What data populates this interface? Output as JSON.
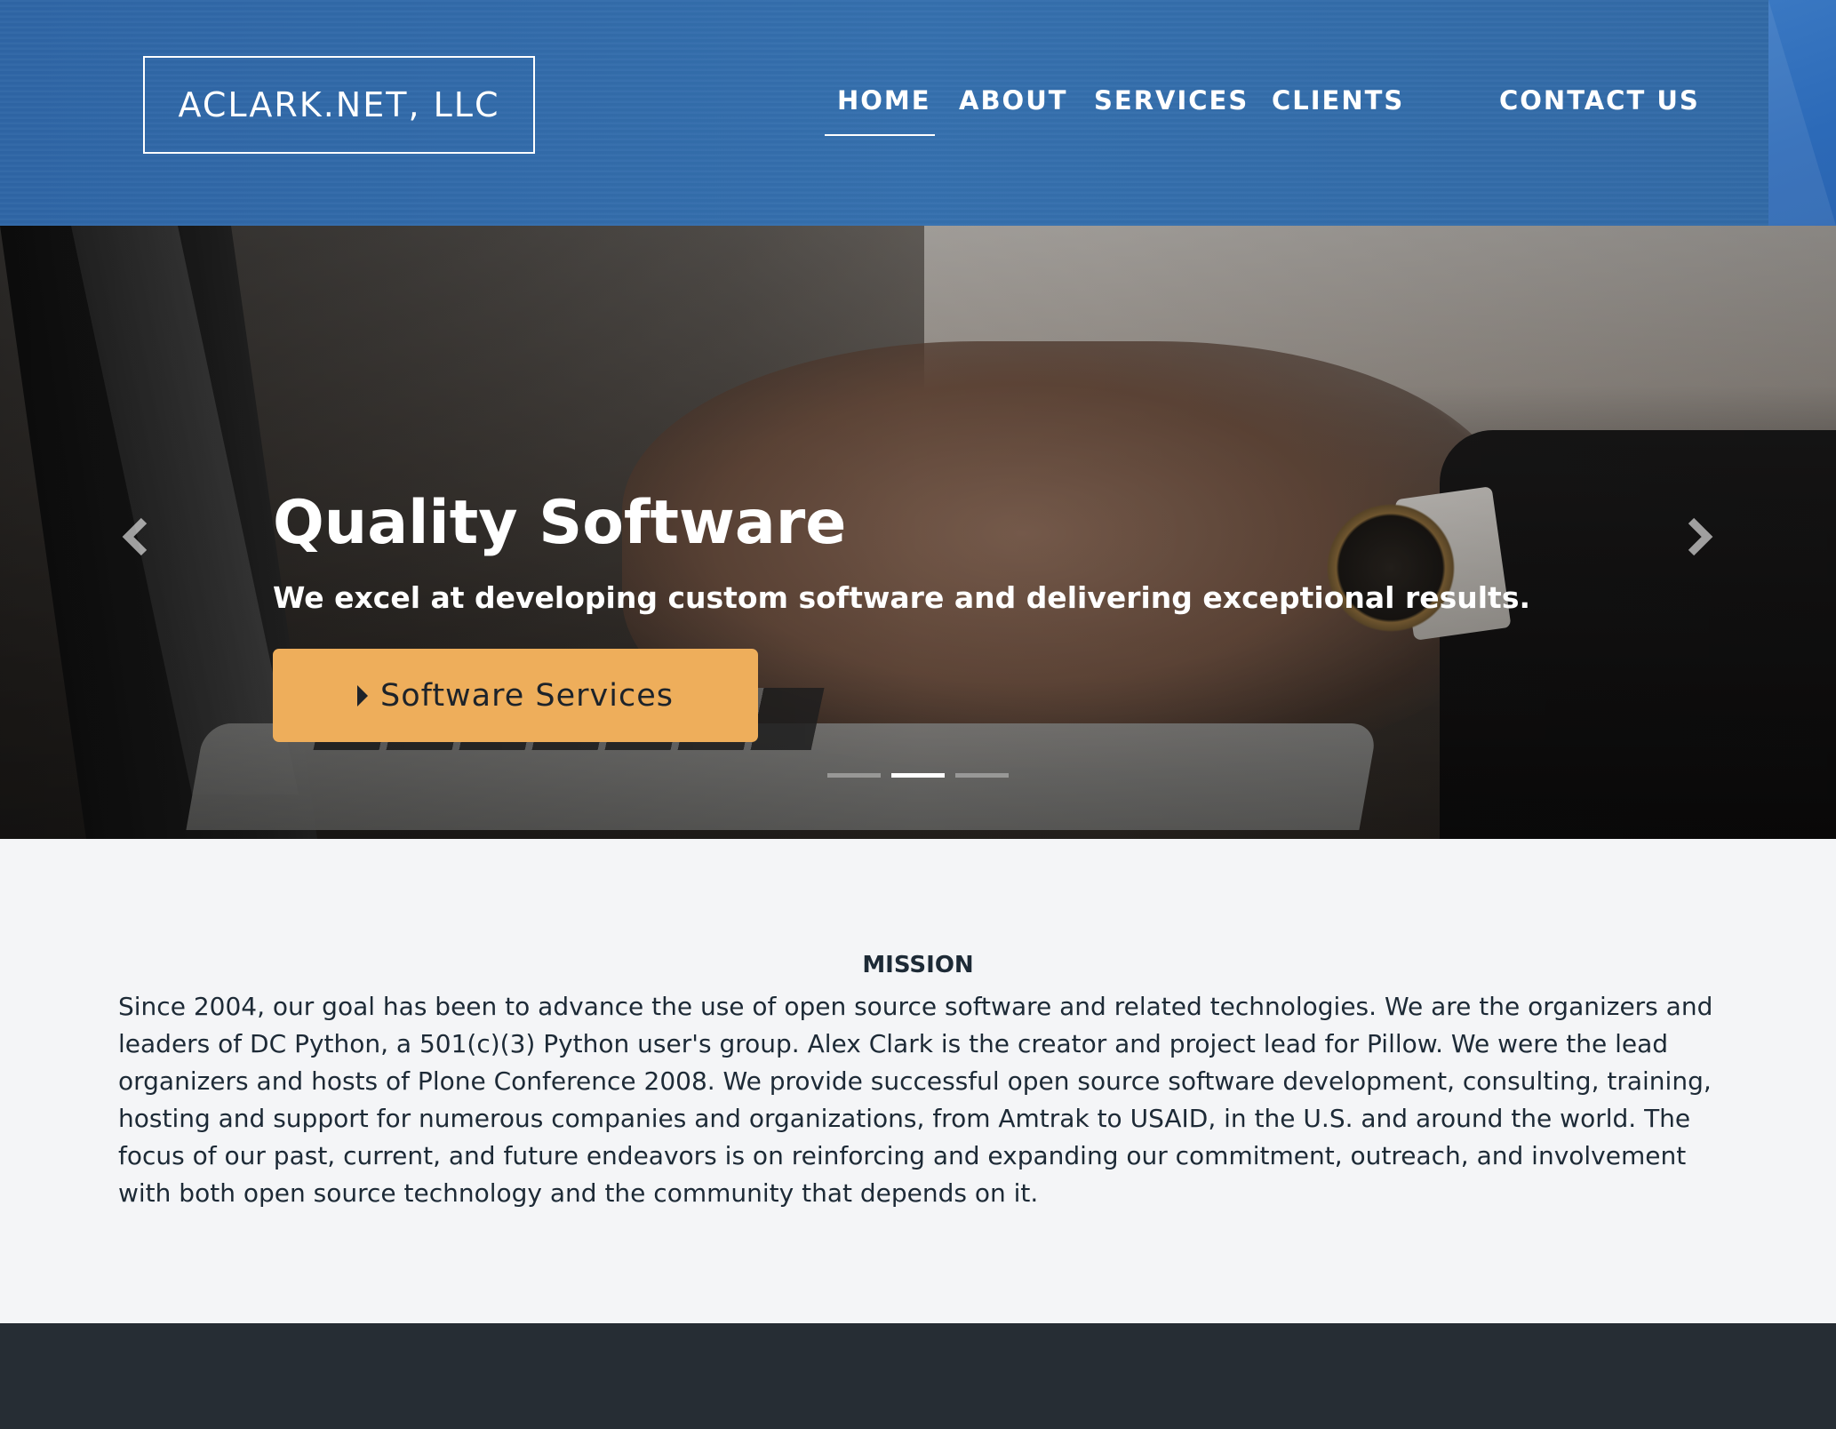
{
  "header": {
    "logo_text": "ACLARK.NET, LLC",
    "nav": [
      {
        "label": "HOME",
        "active": true
      },
      {
        "label": "ABOUT",
        "active": false
      },
      {
        "label": "SERVICES",
        "active": false
      },
      {
        "label": "CLIENTS",
        "active": false
      },
      {
        "label": "CONTACT US",
        "active": false
      }
    ]
  },
  "hero": {
    "title": "Quality Software",
    "subtitle": "We excel at developing custom software and delivering exceptional results.",
    "button_label": "Software Services",
    "button_icon": "caret-right-icon",
    "prev_icon": "chevron-left-icon",
    "next_icon": "chevron-right-icon",
    "slides_total": 3,
    "active_slide": 2
  },
  "mission": {
    "heading": "MISSION",
    "text": "Since 2004, our goal has been to advance the use of open source software and related technologies. We are the organizers and leaders of DC Python, a 501(c)(3) Python user's group. Alex Clark is the creator and project lead for Pillow. We were the lead organizers and hosts of Plone Conference 2008. We provide successful open source software development, consulting, training, hosting and support for numerous companies and organizations, from Amtrak to USAID, in the U.S. and around the world. The focus of our past, current, and future endeavors is on reinforcing and expanding our commitment, outreach, and involvement with both open source technology and the community that depends on it."
  },
  "colors": {
    "header_blue": "#3570ae",
    "button_orange": "#eeae5b",
    "footer_dark": "#262d34",
    "body_bg": "#f4f5f7",
    "text_dark": "#1d2a36"
  }
}
